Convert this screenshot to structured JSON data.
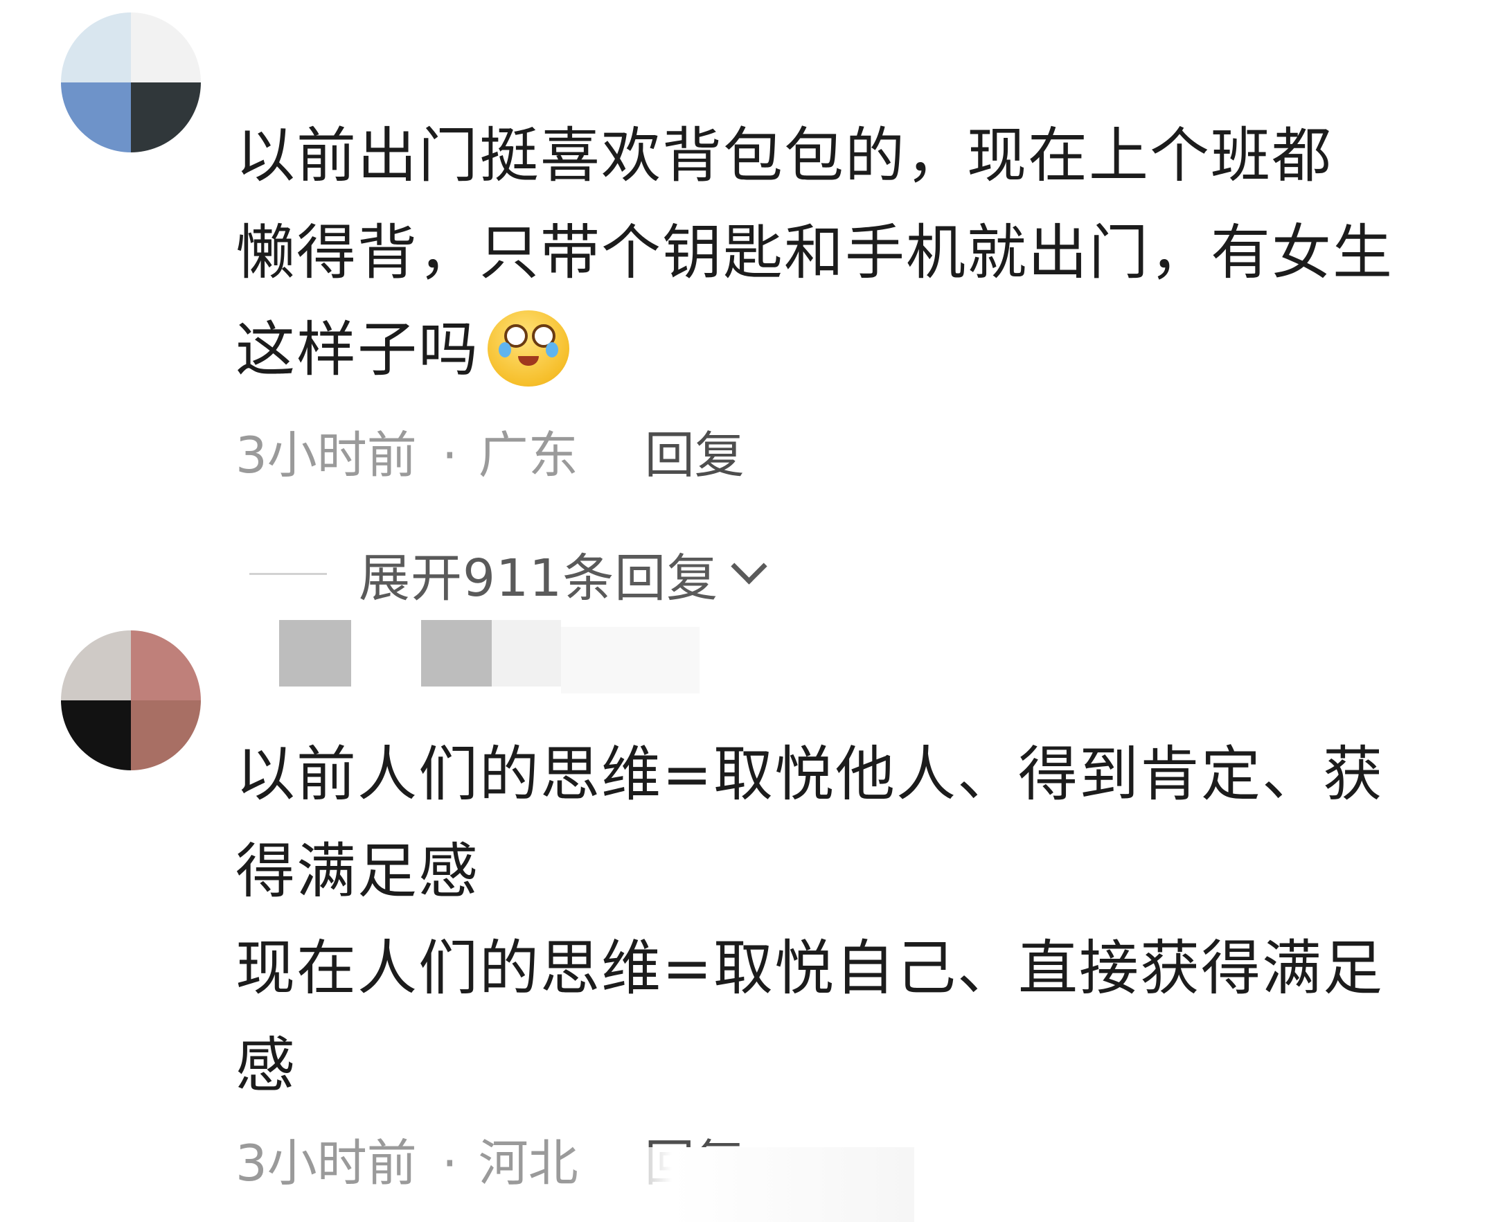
{
  "comments": [
    {
      "text_parts": [
        "以前出门挺喜欢背包包的，现在上个班都\n懒得背，只带个钥匙和手机就出门，有女生\n这样子吗"
      ],
      "emoji_icon": "laughing-crying-emoji",
      "time": "3小时前",
      "separator": "·",
      "location": "广东",
      "reply_label": "回复"
    },
    {
      "text": "以前人们的思维=取悦他人、得到肯定、获\n得满足感\n现在人们的思维=取悦自己、直接获得满足\n感",
      "time": "3小时前",
      "separator": "·",
      "location": "河北",
      "reply_label": "回复"
    }
  ],
  "expand_replies": {
    "label": "展开911条回复",
    "icon": "chevron-down-icon"
  }
}
